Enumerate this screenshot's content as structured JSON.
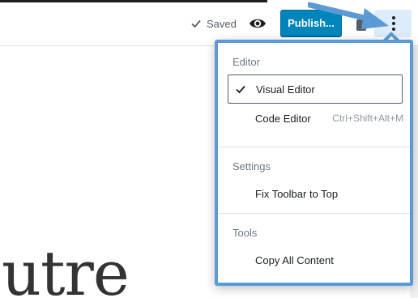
{
  "header": {
    "saved_label": "Saved",
    "publish_label": "Publish..."
  },
  "content": {
    "visible_text": "utre"
  },
  "menu": {
    "groups": [
      {
        "label": "Editor",
        "items": [
          {
            "label": "Visual Editor",
            "checked": true,
            "shortcut": ""
          },
          {
            "label": "Code Editor",
            "checked": false,
            "shortcut": "Ctrl+Shift+Alt+M"
          }
        ]
      },
      {
        "label": "Settings",
        "items": [
          {
            "label": "Fix Toolbar to Top",
            "checked": false,
            "shortcut": ""
          }
        ]
      },
      {
        "label": "Tools",
        "items": [
          {
            "label": "Copy All Content",
            "checked": false,
            "shortcut": ""
          }
        ]
      }
    ]
  },
  "icons": {
    "saved": "check-icon",
    "preview": "eye-icon",
    "more": "more-vertical-icon",
    "checked": "check-icon",
    "annotation": "arrow-annotation"
  },
  "colors": {
    "publish_bg": "#0085ba",
    "highlight_border": "#5b9bd5",
    "arrow": "#5b9bd5"
  }
}
